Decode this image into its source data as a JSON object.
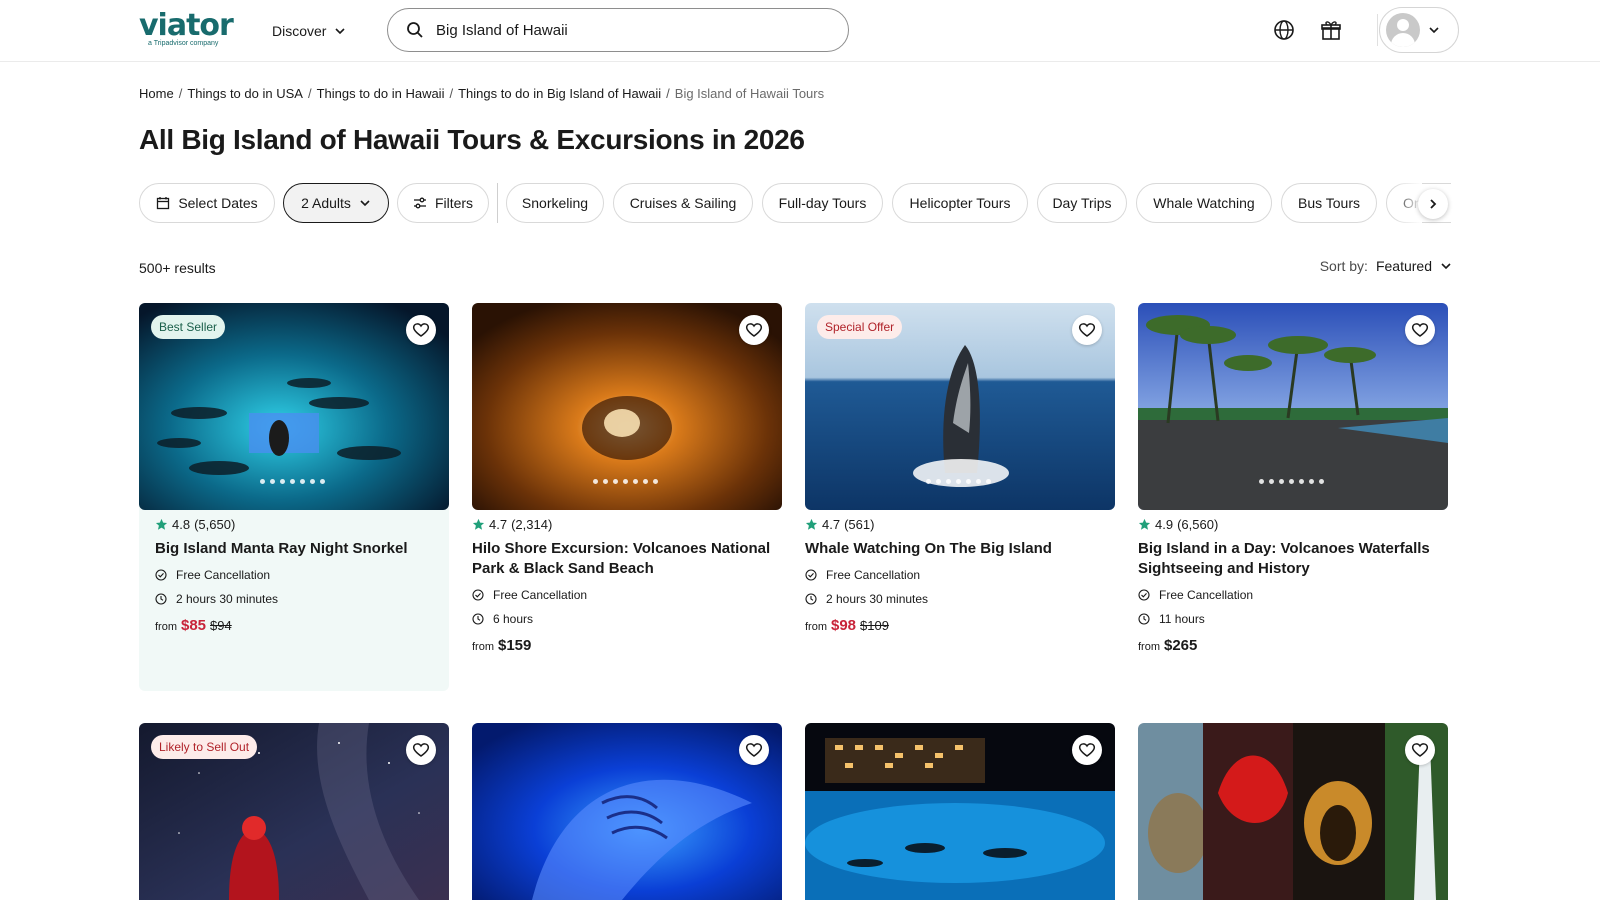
{
  "header": {
    "logo_text": "viator",
    "logo_subtext": "a Tripadvisor company",
    "discover_label": "Discover",
    "search_value": "Big Island of Hawaii",
    "globe_icon": "globe-icon",
    "gift_icon": "gift-icon"
  },
  "breadcrumb": {
    "items": [
      "Home",
      "Things to do in USA",
      "Things to do in Hawaii",
      "Things to do in Big Island of Hawaii"
    ],
    "current": "Big Island of Hawaii Tours"
  },
  "page_title": "All Big Island of Hawaii Tours & Excursions in 2026",
  "filters": {
    "select_dates": "Select Dates",
    "adults": "2 Adults",
    "filters": "Filters",
    "categories": [
      "Snorkeling",
      "Cruises & Sailing",
      "Full-day Tours",
      "Helicopter Tours",
      "Day Trips",
      "Whale Watching",
      "Bus Tours",
      "On"
    ]
  },
  "results_count": "500+ results",
  "sort": {
    "label": "Sort by:",
    "value": "Featured"
  },
  "cards": [
    {
      "badge": "Best Seller",
      "rating": "4.8",
      "reviews": "(5,650)",
      "title": "Big Island Manta Ray Night Snorkel",
      "cancellation": "Free Cancellation",
      "duration": "2 hours 30 minutes",
      "from": "from",
      "price": "$85",
      "old_price": "$94"
    },
    {
      "badge": "",
      "rating": "4.7",
      "reviews": "(2,314)",
      "title": "Hilo Shore Excursion: Volcanoes National Park & Black Sand Beach",
      "cancellation": "Free Cancellation",
      "duration": "6 hours",
      "from": "from",
      "price": "$159",
      "old_price": ""
    },
    {
      "badge": "Special Offer",
      "rating": "4.7",
      "reviews": "(561)",
      "title": "Whale Watching On The Big Island",
      "cancellation": "Free Cancellation",
      "duration": "2 hours 30 minutes",
      "from": "from",
      "price": "$98",
      "old_price": "$109"
    },
    {
      "badge": "",
      "rating": "4.9",
      "reviews": "(6,560)",
      "title": "Big Island in a Day: Volcanoes Waterfalls Sightseeing and History",
      "cancellation": "Free Cancellation",
      "duration": "11 hours",
      "from": "from",
      "price": "$265",
      "old_price": ""
    },
    {
      "badge": "Likely to Sell Out"
    },
    {
      "badge": ""
    },
    {
      "badge": ""
    },
    {
      "badge": ""
    }
  ],
  "colors": {
    "brand": "#186b6d",
    "rating_star": "#21a07a",
    "sale_price": "#c8243a",
    "highlight_card": "#f1f9f7"
  }
}
